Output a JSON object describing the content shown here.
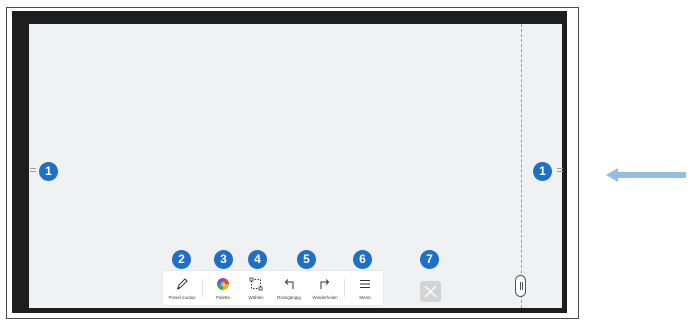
{
  "callouts": [
    "1",
    "1",
    "2",
    "3",
    "4",
    "5",
    "6",
    "7"
  ],
  "toolbar": {
    "tools": [
      {
        "label": "Pinsel modus",
        "icon": "pen-icon"
      },
      {
        "label": "Palette",
        "icon": "palette-icon"
      },
      {
        "label": "Wählen",
        "icon": "select-icon"
      },
      {
        "label": "Rückgängig",
        "icon": "undo-icon"
      },
      {
        "label": "Wiederholen",
        "icon": "redo-icon"
      },
      {
        "label": "Menü",
        "icon": "menu-icon"
      }
    ]
  },
  "close_icon": "close-icon",
  "colors": {
    "callout": "#1e6fc6",
    "arrow": "#93bde3",
    "bezel": "#1e1e1e",
    "screen": "#f0f1f3"
  }
}
